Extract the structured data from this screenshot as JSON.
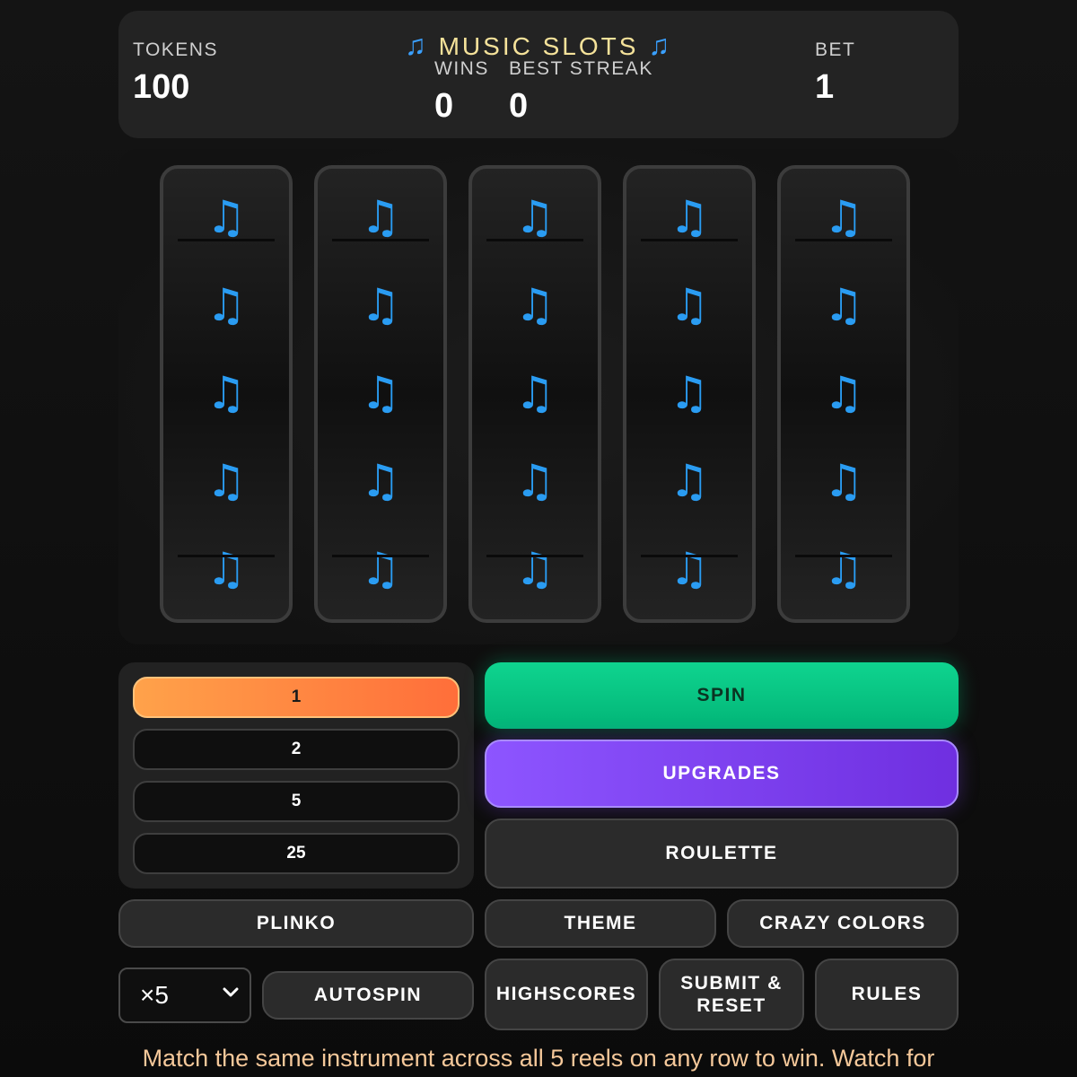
{
  "header": {
    "title": "MUSIC SLOTS",
    "title_icon": "♫",
    "tokens_label": "TOKENS",
    "tokens_value": "100",
    "wins_label": "WINS",
    "wins_value": "0",
    "streak_label": "BEST STREAK",
    "streak_value": "0",
    "bet_label": "BET",
    "bet_value": "1"
  },
  "reels": {
    "symbol": "♫",
    "count": 5,
    "rows": 5
  },
  "bet_options": [
    "1",
    "2",
    "5",
    "25"
  ],
  "selected_bet": "1",
  "buttons": {
    "spin": "SPIN",
    "upgrades": "UPGRADES",
    "roulette": "ROULETTE",
    "plinko": "PLINKO",
    "theme": "THEME",
    "crazy_colors": "CRAZY COLORS",
    "autospin": "AUTOSPIN",
    "highscores": "HIGHSCORES",
    "submit_reset": "SUBMIT & RESET",
    "rules": "RULES"
  },
  "autospin_select": {
    "value": "×5"
  },
  "hint": "Match the same instrument across all 5 reels on any row to win. Watch for",
  "colors": {
    "spin": "#0fd48f",
    "upgrades": "#8d55ff",
    "selected_bet": "#ff8a42",
    "symbol": "#2a9cf2"
  }
}
